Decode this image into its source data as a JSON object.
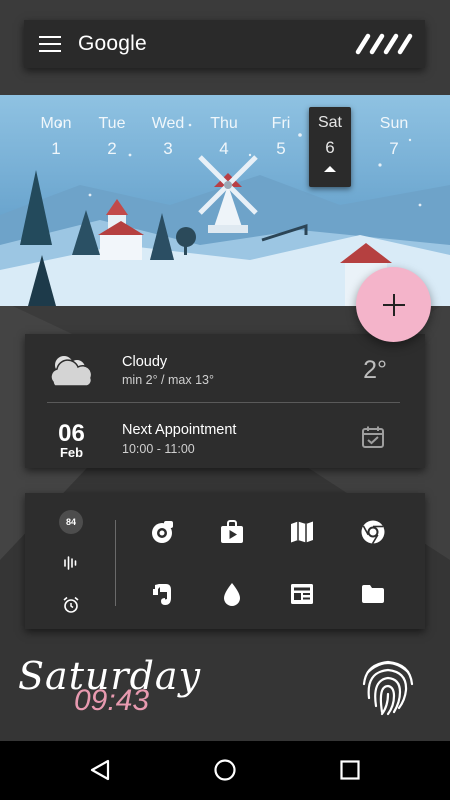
{
  "search_bar": {
    "label": "Google",
    "menu_icon": "menu-icon",
    "brand_icon": "stripes-logo-icon"
  },
  "calendar": {
    "days": [
      {
        "name": "Mon",
        "date": "1"
      },
      {
        "name": "Tue",
        "date": "2"
      },
      {
        "name": "Wed",
        "date": "3"
      },
      {
        "name": "Thu",
        "date": "4"
      },
      {
        "name": "Fri",
        "date": "5"
      },
      {
        "name": "Sat",
        "date": "6",
        "selected": true
      },
      {
        "name": "Sun",
        "date": "7"
      }
    ]
  },
  "fab": {
    "icon": "plus-icon",
    "color": "#f4b4ca"
  },
  "weather": {
    "condition": "Cloudy",
    "range": "min  2° / max  13°",
    "temperature": "2°",
    "icon": "cloud-icon"
  },
  "appointment": {
    "day": "06",
    "month": "Feb",
    "title": "Next Appointment",
    "time": "10:00 - 11:00",
    "icon": "calendar-check-icon"
  },
  "apps": {
    "battery_badge": "84",
    "side_icons": [
      "battery-badge",
      "sound-wave-icon",
      "alarm-clock-icon"
    ],
    "grid_icons": [
      "camera-icon",
      "play-store-icon",
      "maps-icon",
      "chrome-icon",
      "evernote-icon",
      "drop-icon",
      "newspaper-icon",
      "folder-icon"
    ]
  },
  "clock": {
    "day": "Saturday",
    "time": "09:43",
    "accent": "#e89ab0"
  },
  "fingerprint_icon": "fingerprint-icon",
  "nav": {
    "icons": [
      "back-icon",
      "home-icon",
      "recents-icon"
    ]
  }
}
